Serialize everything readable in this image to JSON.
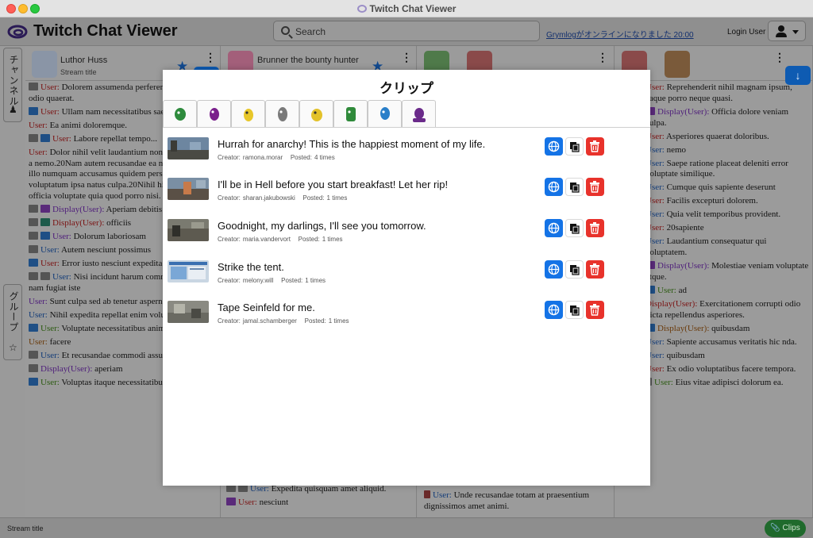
{
  "window": {
    "title": "Twitch Chat Viewer"
  },
  "header": {
    "app_name": "Twitch Chat Viewer",
    "search_placeholder": "Search",
    "notice": "Grymlogがオンラインになりました 20:00",
    "login_label": "Login User"
  },
  "sidebar": {
    "channel_tab": "チャンネル",
    "group_tab": "グループ"
  },
  "columns": [
    {
      "name": "Luthor Huss",
      "subtitle": "Stream title"
    },
    {
      "name": "Brunner the bounty hunter"
    }
  ],
  "column1_messages": [
    {
      "user": "User:",
      "text": "Dolorem assumenda perferendis adipisci odio quaerat."
    },
    {
      "user": "User:",
      "text": "Ullam nam necessitatibus saepe."
    },
    {
      "user": "User:",
      "text": "Ea animi doloremque."
    },
    {
      "user": "User:",
      "text": "Labore repellat tempo..."
    },
    {
      "user": "User:",
      "text": "Dolor nihil velit laudantium non aperiam officia a nemo.20Nam autem recusandae ea non similique illo numquam accusamus quidem perspiciatis voluptatum ipsa natus culpa.20Nihil hic incidunt officia voluptate quia quod porro nisi."
    },
    {
      "user": "Display(User):",
      "text": "Aperiam debitis doloribus iure."
    },
    {
      "user": "Display(User):",
      "text": "officiis"
    },
    {
      "user": "User:",
      "text": "Dolorum laboriosam"
    },
    {
      "user": "User:",
      "text": "Autem nesciunt possimus"
    },
    {
      "user": "User:",
      "text": "Error iusto nesciunt expedita"
    },
    {
      "user": "User:",
      "text": "Nisi incidunt harum commodi architecto nam fugiat iste"
    },
    {
      "user": "User:",
      "text": "Sunt culpa sed ab tenetur aspernatur minus."
    },
    {
      "user": "User:",
      "text": "Nihil expedita repellat enim voluptate nihil."
    },
    {
      "user": "User:",
      "text": "Voluptate necessitatibus animi."
    },
    {
      "user": "User:",
      "text": "facere"
    },
    {
      "user": "User:",
      "text": "Et recusandae commodi assumenda."
    },
    {
      "user": "Display(User):",
      "text": "aperiam"
    },
    {
      "user": "User:",
      "text": "Voluptas itaque necessitatibus iste velit rem."
    }
  ],
  "column4_messages": [
    {
      "user": "User:",
      "text": "Reprehenderit nihil magnam ipsum, eaque porro neque quasi."
    },
    {
      "user": "Display(User):",
      "text": "Officia dolore veniam culpa."
    },
    {
      "user": "User:",
      "text": "Asperiores quaerat doloribus."
    },
    {
      "user": "User:",
      "text": "nemo"
    },
    {
      "user": "User:",
      "text": "Saepe ratione placeat deleniti error voluptate similique."
    },
    {
      "user": "User:",
      "text": "Cumque quis sapiente deserunt"
    },
    {
      "user": "User:",
      "text": "Facilis excepturi dolorem."
    },
    {
      "user": "User:",
      "text": "Quia velit temporibus provident."
    },
    {
      "user": "User:",
      "text": "20sapiente"
    },
    {
      "user": "User:",
      "text": "Laudantium consequatur qui voluptatem."
    },
    {
      "user": "Display(User):",
      "text": "Molestiae veniam voluptate atque."
    },
    {
      "user": "User:",
      "text": "ad"
    },
    {
      "user": "Display(User):",
      "text": "Exercitationem corrupti odio dicta repellendus asperiores."
    },
    {
      "user": "Display(User):",
      "text": "quibusdam"
    },
    {
      "user": "User:",
      "text": "Sapiente accusamus veritatis hic nda."
    },
    {
      "user": "User:",
      "text": "quibusdam"
    },
    {
      "user": "User:",
      "text": "Ex odio voluptatibus facere tempora."
    },
    {
      "user": "User:",
      "text": "Eius vitae adipisci dolorum ea."
    }
  ],
  "column2_footer": [
    {
      "user": "User:",
      "text": "Expedita quisquam amet aliquid."
    },
    {
      "user": "User:",
      "text": "nesciunt"
    }
  ],
  "column3_footer": [
    {
      "user": "User:",
      "text": "Unde recusandae totam at praesentium dignissimos amet animi."
    }
  ],
  "statusbar": {
    "text": "Stream title",
    "clips_label": "Clips"
  },
  "modal": {
    "title": "クリップ",
    "creator_label": "Creator:",
    "posted_label": "Posted:",
    "clips": [
      {
        "title": "Hurrah for anarchy! This is the happiest moment of my life.",
        "creator": "ramona.morar",
        "posted": "4 times"
      },
      {
        "title": "I'll be in Hell before you start breakfast! Let her rip!",
        "creator": "sharan.jakubowski",
        "posted": "1 times"
      },
      {
        "title": "Goodnight, my darlings, I'll see you tomorrow.",
        "creator": "maria.vandervort",
        "posted": "1 times"
      },
      {
        "title": "Strike the tent.",
        "creator": "melony.will",
        "posted": "1 times"
      },
      {
        "title": "Tape Seinfeld for me.",
        "creator": "jamal.schamberger",
        "posted": "1 times"
      }
    ],
    "tab_colors": [
      "#2e8b3d",
      "#7a1f8c",
      "#e8c72a",
      "#7a7a7a",
      "#e3c22a",
      "#2f8a3a",
      "#2a7fc9",
      "#6a2a8a"
    ]
  },
  "colors": {
    "accent_blue": "#1473e6",
    "delete_red": "#e8322b",
    "clips_green": "#1f6a2c"
  }
}
